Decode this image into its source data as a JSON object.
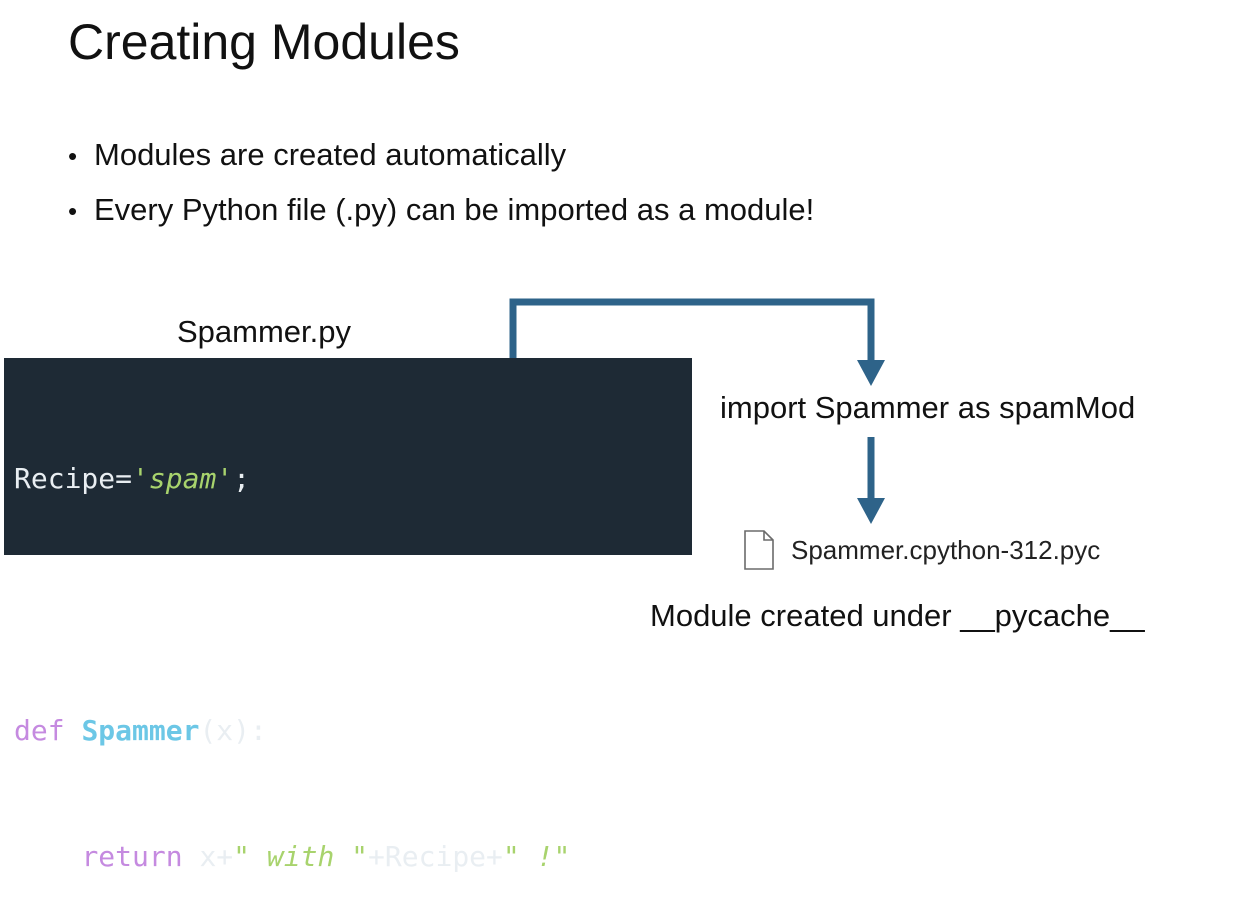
{
  "slide": {
    "title": "Creating Modules",
    "bullets": [
      "Modules are created automatically",
      "Every Python file (.py) can be imported as a module!"
    ]
  },
  "code": {
    "filename": "Spammer.py",
    "line1": {
      "var": "Recipe=",
      "str": "'spam'",
      "end": ";"
    },
    "line3": {
      "kw": "def ",
      "fn": "Spammer",
      "rest": "(x):"
    },
    "line4": {
      "indent": "    ",
      "kw": "return",
      "a": " x+",
      "s1": "\" with \"",
      "b": "+Recipe+",
      "s2": "\" !\""
    }
  },
  "diagram": {
    "import_statement": "import Spammer as spamMod",
    "compiled_file": "Spammer.cpython-312.pyc",
    "note": "Module created under __pycache__",
    "arrow_color": "#2e6389",
    "file_icon": "file-icon"
  }
}
